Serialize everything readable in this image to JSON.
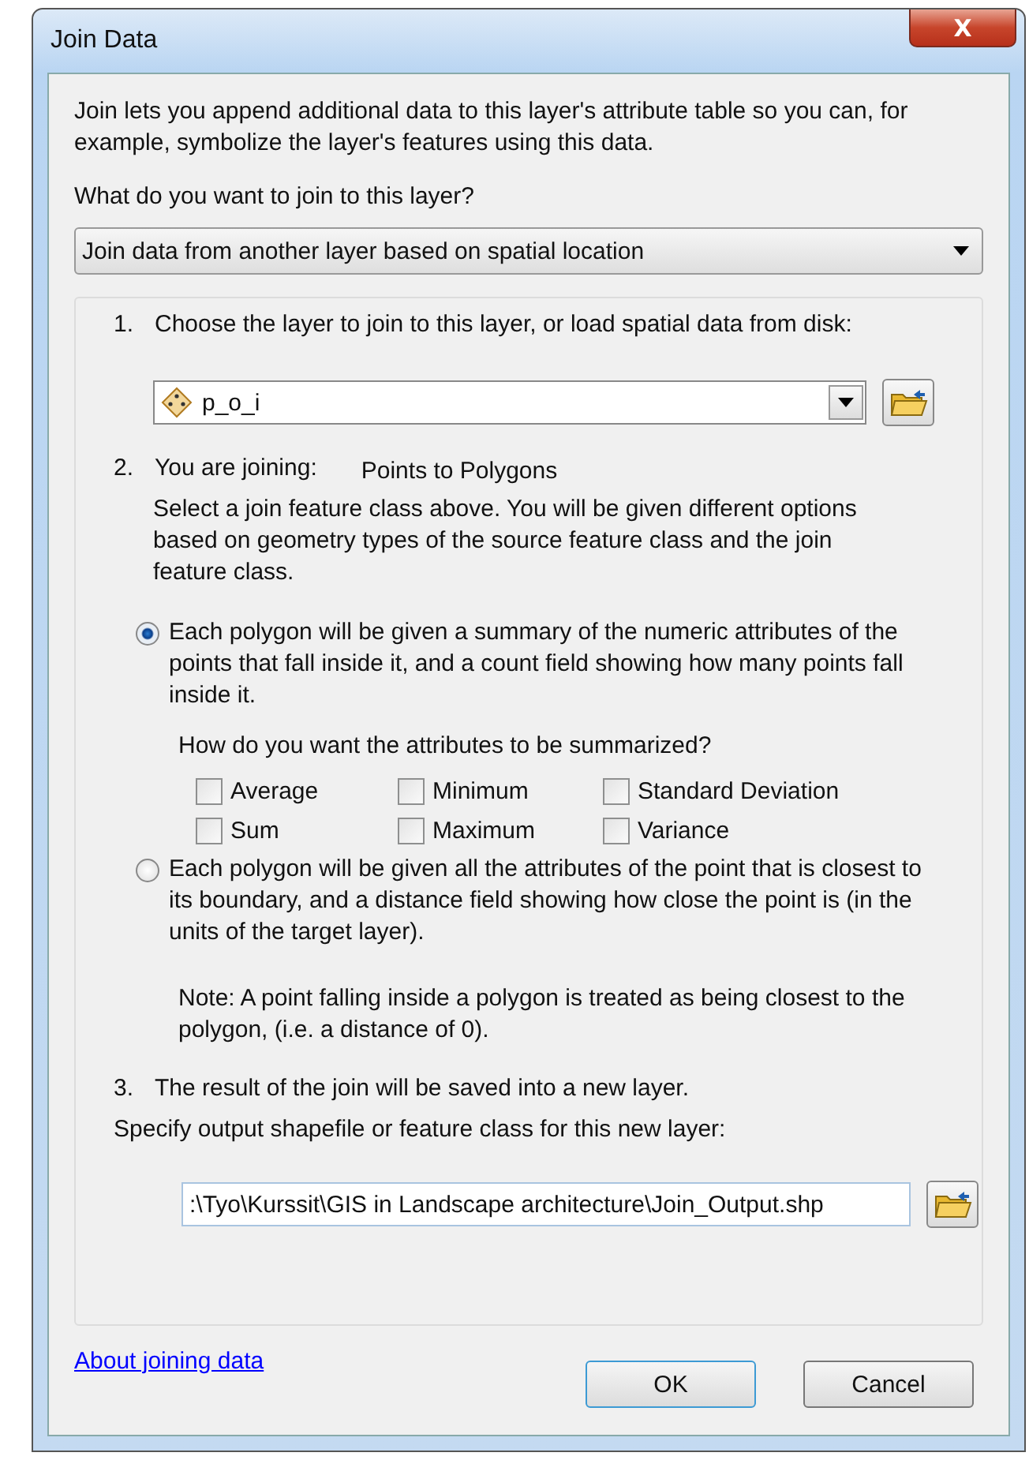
{
  "window": {
    "title": "Join Data",
    "close": "X"
  },
  "intro": "Join lets you append additional data to this layer's attribute table so you can, for example, symbolize the layer's features using this data.",
  "question": "What do you want to join to this layer?",
  "join_type": {
    "value": "Join data from another layer based on spatial location"
  },
  "step1": {
    "number": "1.",
    "label": "Choose the layer to join to this layer, or load spatial data from disk:",
    "layer": "p_o_i"
  },
  "step2": {
    "number": "2.",
    "label": "You are joining:",
    "joining": "Points to Polygons",
    "description": "Select a join feature class above.  You will be given different options based on geometry types of the source feature class and the join feature class.",
    "options": [
      {
        "label": "Each polygon will be given a summary of the numeric attributes of the points that fall inside it, and a count field showing how many points fall inside it.",
        "selected": true
      },
      {
        "label": "Each polygon will be given all the attributes of the point that is closest to its boundary, and a distance field showing how close the point is (in the units of the target layer).",
        "selected": false
      }
    ],
    "summary_question": "How do you want the attributes to be summarized?",
    "statistics": [
      {
        "label": "Average",
        "checked": false
      },
      {
        "label": "Minimum",
        "checked": false
      },
      {
        "label": "Standard Deviation",
        "checked": false
      },
      {
        "label": "Sum",
        "checked": false
      },
      {
        "label": "Maximum",
        "checked": false
      },
      {
        "label": "Variance",
        "checked": false
      }
    ],
    "note": "Note: A point falling inside a polygon is treated as being closest to the polygon, (i.e. a distance of 0)."
  },
  "step3": {
    "number": "3.",
    "label": "The result of the join will be saved into a new layer.",
    "output_label": "Specify output shapefile or feature class for this new layer:",
    "output_path": ":\\Tyo\\Kurssit\\GIS in Landscape architecture\\Join_Output.shp"
  },
  "help_link": "About joining data",
  "buttons": [
    "OK",
    "Cancel"
  ]
}
